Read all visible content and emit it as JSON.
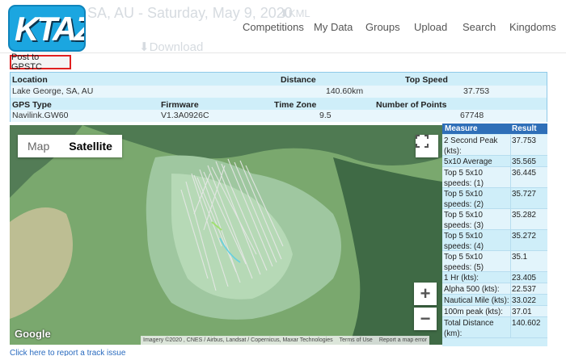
{
  "header": {
    "logo_text": "KTAZ",
    "title_faded": "SA, AU - Saturday, May 9, 2020",
    "kml_faded": "KML",
    "download_faded": "Download",
    "nav": [
      "Competitions",
      "My Data",
      "Groups",
      "Upload",
      "Search",
      "Kingdoms"
    ]
  },
  "post_button": "Post to GPSTC",
  "info": {
    "location_label": "Location",
    "location_value": "Lake George, SA, AU",
    "distance_label": "Distance",
    "distance_value": "140.60km",
    "top_speed_label": "Top Speed",
    "top_speed_value": "37.753",
    "gps_type_label": "GPS Type",
    "gps_type_value": "Navilink.GW60",
    "firmware_label": "Firmware",
    "firmware_value": "V1.3A0926C",
    "time_zone_label": "Time Zone",
    "time_zone_value": "9.5",
    "points_label": "Number of Points",
    "points_value": "67748"
  },
  "map": {
    "type_map": "Map",
    "type_satellite": "Satellite",
    "zoom_in": "+",
    "zoom_out": "−",
    "google": "Google",
    "attribution": "Imagery ©2020 , CNES / Airbus, Landsat / Copernicus, Maxar Technologies",
    "terms": "Terms of Use",
    "report_error": "Report a map error"
  },
  "measures": {
    "header_measure": "Measure",
    "header_result": "Result",
    "rows": [
      {
        "label": "2 Second Peak (kts):",
        "value": "37.753"
      },
      {
        "label": "5x10 Average (kts):",
        "value": "35.565"
      },
      {
        "label": "Top 5 5x10 speeds: (1)",
        "value": "36.445"
      },
      {
        "label": "Top 5 5x10 speeds: (2)",
        "value": "35.727"
      },
      {
        "label": "Top 5 5x10 speeds: (3)",
        "value": "35.282"
      },
      {
        "label": "Top 5 5x10 speeds: (4)",
        "value": "35.272"
      },
      {
        "label": "Top 5 5x10 speeds: (5)",
        "value": "35.1"
      },
      {
        "label": "1 Hr (kts):",
        "value": "23.405"
      },
      {
        "label": "Alpha 500 (kts):",
        "value": "22.537"
      },
      {
        "label": "Nautical Mile (kts):",
        "value": "33.022"
      },
      {
        "label": "100m peak (kts):",
        "value": "37.01"
      },
      {
        "label": "Total Distance (km):",
        "value": "140.602"
      }
    ]
  },
  "footer": {
    "report_link": "Click here to report a track issue"
  }
}
